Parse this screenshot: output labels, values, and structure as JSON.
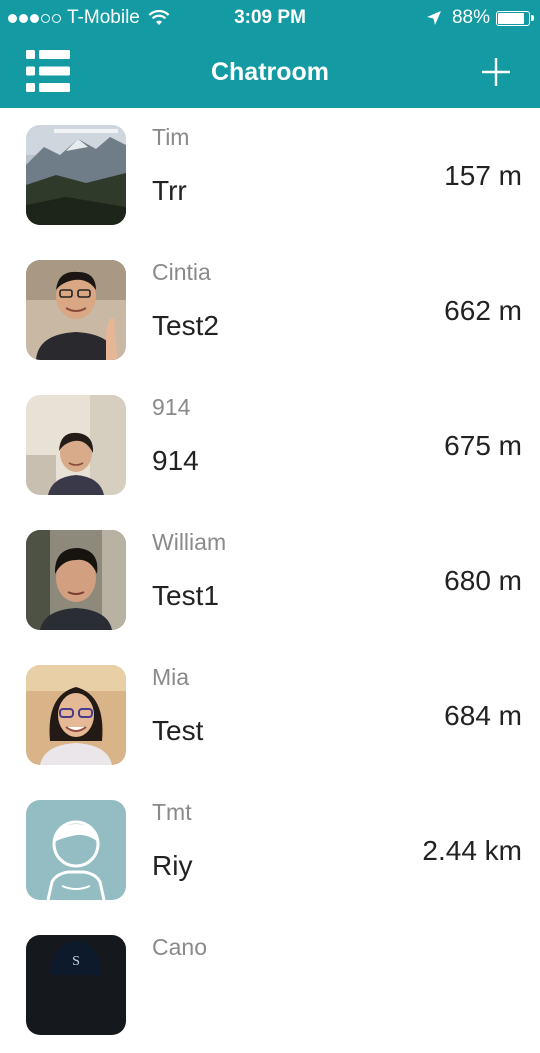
{
  "status_bar": {
    "carrier": "T-Mobile",
    "signal_bars_filled": 3,
    "signal_bars_total": 5,
    "time": "3:09 PM",
    "battery_percent": "88%",
    "battery_level": 0.88
  },
  "nav": {
    "title": "Chatroom",
    "menu_icon": "list-icon",
    "add_icon": "plus-icon"
  },
  "colors": {
    "header": "#139aa3",
    "username": "#8a8a8a",
    "text": "#222222"
  },
  "chats": [
    {
      "user": "Tim",
      "message": "Trr",
      "distance": "157 m",
      "avatar": "mountain-photo"
    },
    {
      "user": "Cintia",
      "message": "Test2",
      "distance": "662 m",
      "avatar": "person-photo"
    },
    {
      "user": "914",
      "message": "914",
      "distance": "675 m",
      "avatar": "person-photo"
    },
    {
      "user": "William",
      "message": "Test1",
      "distance": "680 m",
      "avatar": "person-photo"
    },
    {
      "user": "Mia",
      "message": "Test",
      "distance": "684 m",
      "avatar": "person-photo"
    },
    {
      "user": "Tmt",
      "message": "Riy",
      "distance": "2.44 km",
      "avatar": "default-avatar"
    },
    {
      "user": "Cano",
      "message": "",
      "distance": "",
      "avatar": "person-photo"
    }
  ]
}
